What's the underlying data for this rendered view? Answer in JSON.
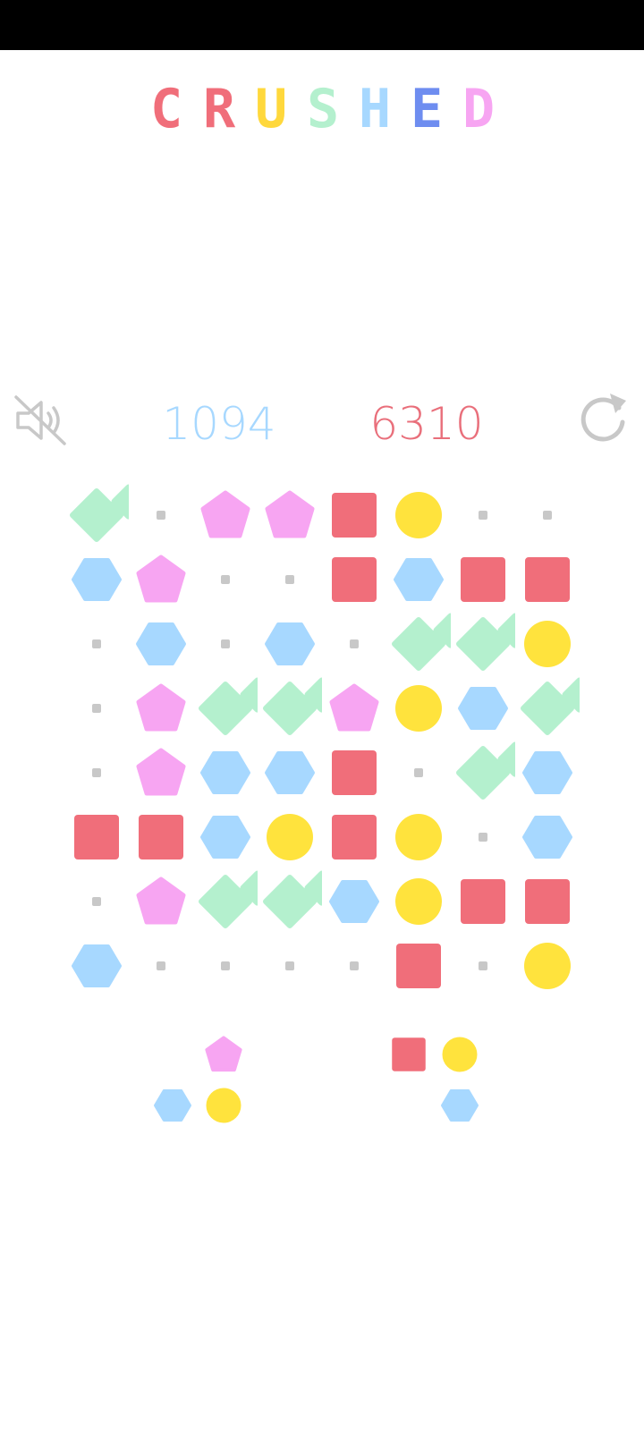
{
  "status_bar": {},
  "logo": {
    "letters": [
      "C",
      "R",
      "U",
      "S",
      "H",
      "E",
      "D"
    ],
    "colors": [
      "#F06E7A",
      "#F06E7A",
      "#FFD83C",
      "#B4F0CE",
      "#A7D8FF",
      "#6E8DF0",
      "#F7A5F2"
    ]
  },
  "scores": {
    "best": "1094",
    "best_color": "#A7D8FF",
    "current": "6310",
    "current_color": "#E96F7B"
  },
  "controls": {
    "mute_icon": "speaker-muted-icon",
    "restart_icon": "restart-icon",
    "icon_color": "#C8C8C8"
  },
  "palette": {
    "diamond": "#B4F0CE",
    "pentagon": "#F7A5F2",
    "square": "#F06E7A",
    "circle": "#FFE33D",
    "hexagon": "#A7D8FF",
    "dot": "#C8C8C8"
  },
  "board": {
    "rows": 8,
    "cols": 8,
    "cells": [
      [
        "diamond",
        "dot",
        "pentagon",
        "pentagon",
        "square",
        "circle",
        "dot",
        "dot"
      ],
      [
        "hexagon",
        "pentagon",
        "dot",
        "dot",
        "square",
        "hexagon",
        "square",
        "square"
      ],
      [
        "dot",
        "hexagon",
        "dot",
        "hexagon",
        "dot",
        "diamond",
        "diamond",
        "circle"
      ],
      [
        "dot",
        "pentagon",
        "diamond",
        "diamond",
        "pentagon",
        "circle",
        "hexagon",
        "diamond"
      ],
      [
        "dot",
        "pentagon",
        "hexagon",
        "hexagon",
        "square",
        "dot",
        "diamond",
        "hexagon"
      ],
      [
        "square",
        "square",
        "hexagon",
        "circle",
        "square",
        "circle",
        "dot",
        "hexagon"
      ],
      [
        "dot",
        "pentagon",
        "diamond",
        "diamond",
        "hexagon",
        "circle",
        "square",
        "square"
      ],
      [
        "hexagon",
        "dot",
        "dot",
        "dot",
        "dot",
        "square",
        "dot",
        "circle"
      ]
    ]
  },
  "pieces": [
    {
      "name": "next-piece-1",
      "cells": [
        {
          "r": 0,
          "c": 1,
          "shape": "pentagon"
        },
        {
          "r": 1,
          "c": 0,
          "shape": "hexagon"
        },
        {
          "r": 1,
          "c": 1,
          "shape": "circle"
        }
      ]
    },
    {
      "name": "next-piece-2",
      "cells": [
        {
          "r": 0,
          "c": 0,
          "shape": "square"
        },
        {
          "r": 0,
          "c": 1,
          "shape": "circle"
        },
        {
          "r": 1,
          "c": 1,
          "shape": "hexagon"
        }
      ]
    }
  ]
}
